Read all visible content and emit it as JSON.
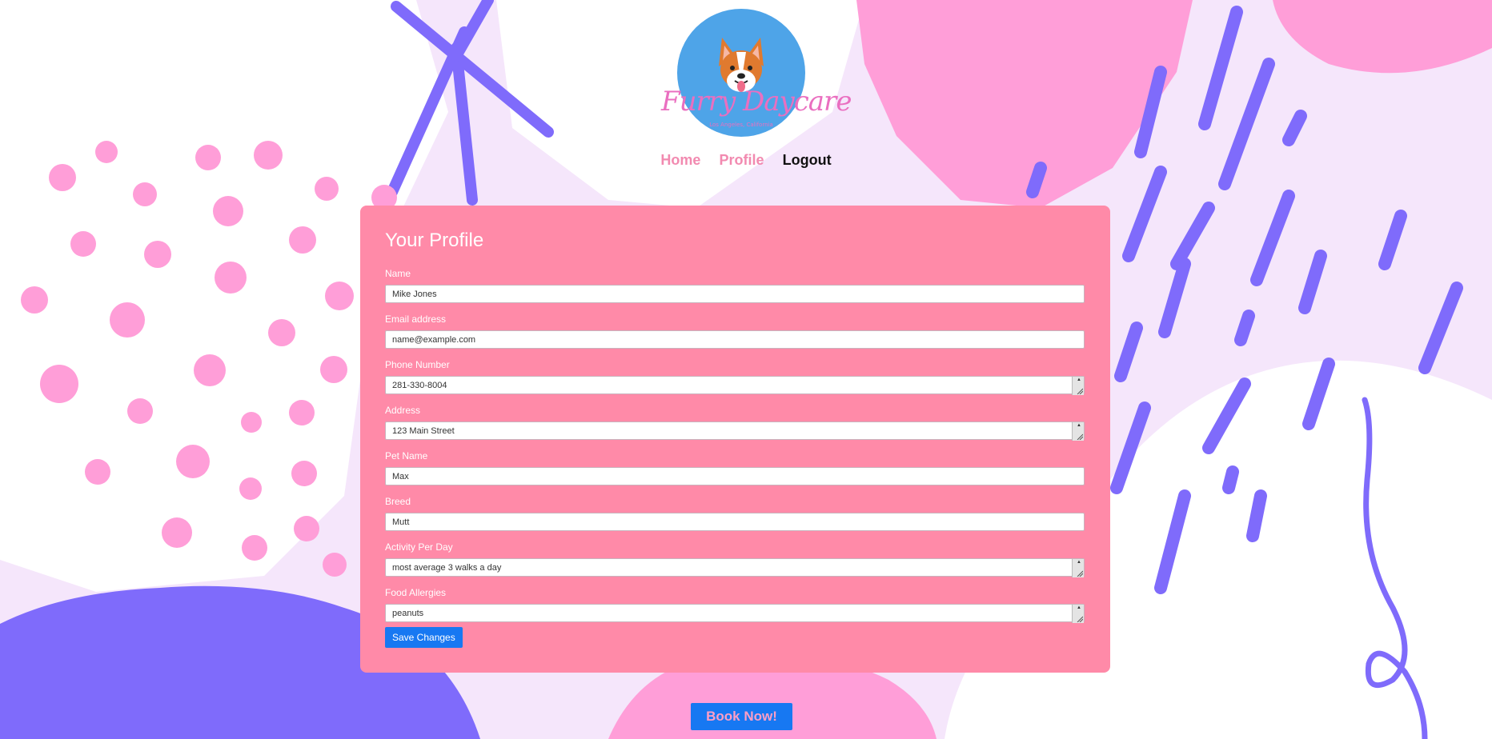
{
  "brand": {
    "logo_title": "Furry Daycare",
    "logo_subtitle": "Los Angeles, California",
    "logo_icon": "corgi-icon"
  },
  "nav": {
    "home": "Home",
    "profile": "Profile",
    "logout": "Logout"
  },
  "profile": {
    "heading": "Your Profile",
    "fields": [
      {
        "label": "Name",
        "value": "Mike Jones",
        "kind": "text"
      },
      {
        "label": "Email address",
        "value": "name@example.com",
        "kind": "text"
      },
      {
        "label": "Phone Number",
        "value": "281-330-8004",
        "kind": "textarea"
      },
      {
        "label": "Address",
        "value": "123 Main Street",
        "kind": "textarea"
      },
      {
        "label": "Pet Name",
        "value": "Max",
        "kind": "text"
      },
      {
        "label": "Breed",
        "value": "Mutt",
        "kind": "text"
      },
      {
        "label": "Activity Per Day",
        "value": "most average 3 walks a day",
        "kind": "textarea"
      },
      {
        "label": "Food Allergies",
        "value": "peanuts",
        "kind": "textarea"
      }
    ],
    "save_label": "Save Changes"
  },
  "cta": {
    "book_label": "Book Now!"
  },
  "colors": {
    "card": "#ff8aa8",
    "button": "#1778f2",
    "nav_active": "#f28ab0",
    "bg_purple": "#7f6bfb",
    "bg_pink": "#ff9ed8"
  }
}
